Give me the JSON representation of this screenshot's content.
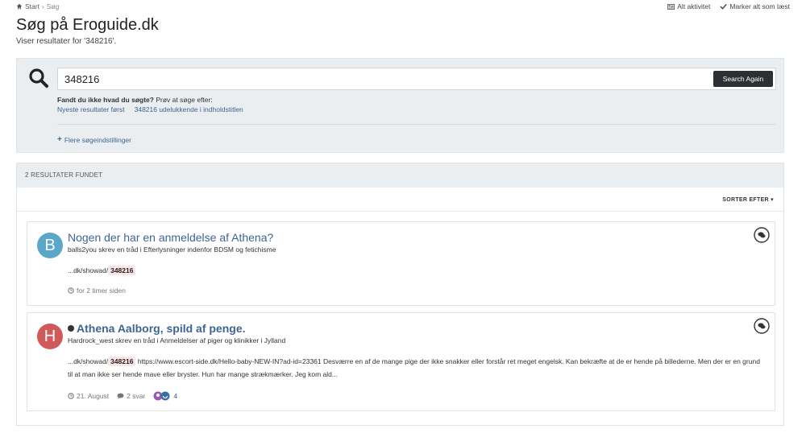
{
  "breadcrumb": {
    "home": "Start",
    "current": "Søg"
  },
  "top_actions": {
    "all_activity": "Alt aktivitet",
    "mark_all_read": "Marker alt som læst"
  },
  "page": {
    "title": "Søg på Eroguide.dk",
    "subtitle": "Viser resultater for '348216'."
  },
  "search": {
    "query": "348216",
    "button": "Search Again",
    "hint_bold": "Fandt du ikke hvad du søgte?",
    "hint_rest": " Prøv at søge efter:",
    "suggestions": [
      "Nyeste resultater først",
      "348216 udelukkende i indholdstitlen"
    ],
    "more_settings": "Flere søgeindstillinger"
  },
  "results": {
    "count_label": "2 RESULTATER FUNDET",
    "sort_label": "SORTER EFTER",
    "items": [
      {
        "avatar_letter": "B",
        "avatar_color": "#5aa7c9",
        "title": "Nogen der har en anmeldelse af Athena?",
        "meta": "balls2you skrev en tråd i Efterlysninger indenfor BDSM og fetichisme",
        "snippet_pre": "...dk/showad/",
        "highlight": "348216",
        "snippet_post": "",
        "time": "for 2 timer siden"
      },
      {
        "avatar_letter": "H",
        "avatar_color": "#d05a5a",
        "title": "Athena Aalborg, spild af penge.",
        "meta": "Hardrock_west skrev en tråd i Anmeldelser af piger og klinikker i Jylland",
        "snippet_pre": "...dk/showad/",
        "highlight": "348216",
        "snippet_post": " https://www.escort-side.dk/Hello-baby-NEW-IN?ad-id=23361 Desværre en af de mange pige der ikke snakker eller forstår ret meget engelsk. Kan bekræfte at de er hende på billederne. Men der er en grund til at man ikke ser hende mave eller bryster. Hun har mange strækmærker. Jeg kom ald...",
        "time": "21. August",
        "replies": "2 svar",
        "reactions": "4"
      }
    ]
  }
}
